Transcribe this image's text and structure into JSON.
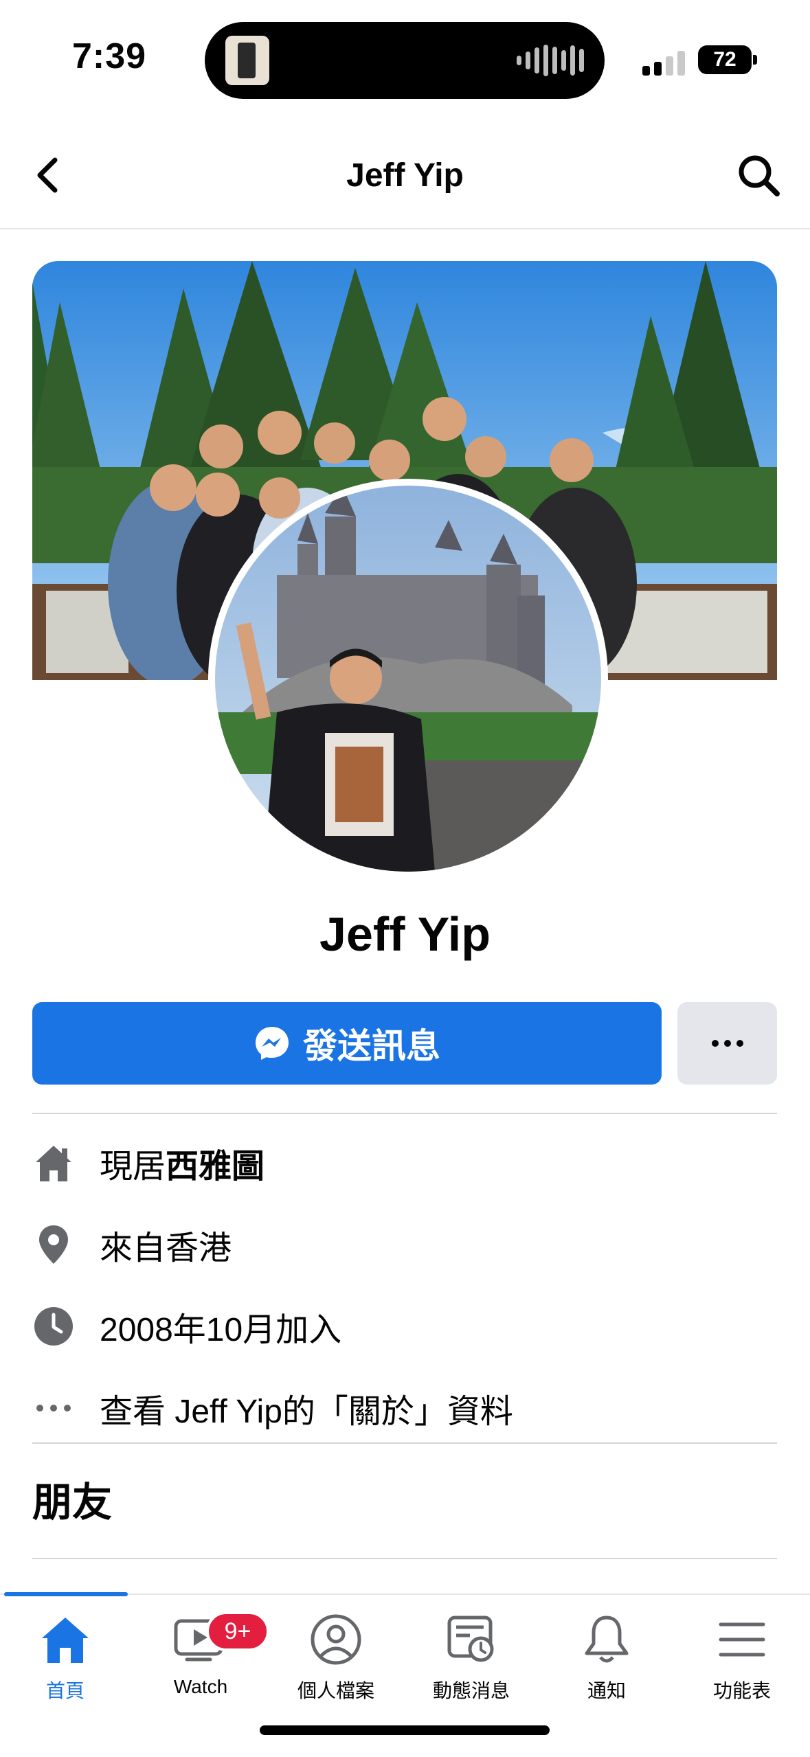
{
  "status_bar": {
    "time": "7:39",
    "battery": "72"
  },
  "header": {
    "title": "Jeff Yip"
  },
  "profile": {
    "name": "Jeff Yip",
    "message_button": "發送訊息",
    "more_button": "···"
  },
  "intro": {
    "lives_prefix": "現居",
    "lives_city": "西雅圖",
    "from": "來自香港",
    "joined": "2008年10月加入",
    "about_link": "查看 Jeff Yip的「關於」資料"
  },
  "friends": {
    "title": "朋友"
  },
  "tabbar": {
    "home": "首頁",
    "watch": "Watch",
    "watch_badge": "9+",
    "profile": "個人檔案",
    "feeds": "動態消息",
    "notifications": "通知",
    "menu": "功能表"
  },
  "colors": {
    "accent": "#1b74e4",
    "badge": "#e41e3f",
    "secondary_button": "#e4e6eb"
  }
}
